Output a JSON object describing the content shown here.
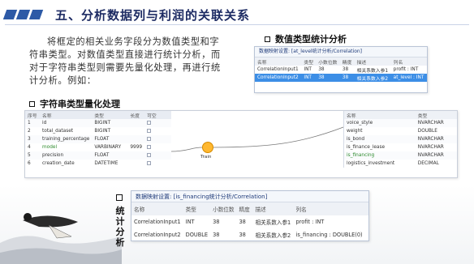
{
  "header": {
    "title": "五、分析数据列与利润的关联关系"
  },
  "intro": {
    "text": "将框定的相关业务字段分为数值类型和字符串类型。对数值类型直接进行统计分析，而对于字符串类型则需要先量化处理，再进行统计分析。例如："
  },
  "sections": {
    "numeric": "数值类型统计分析",
    "string": "字符串类型量化处理",
    "stats_chars": [
      "统",
      "计",
      "分",
      "析"
    ]
  },
  "numeric_panel": {
    "title": "数据映射设置: [at_level统计分析/Correlation]",
    "columns": [
      "名称",
      "类型",
      "小数位数",
      "精度",
      "描述",
      "列名"
    ],
    "rows": [
      [
        "CorrelationInput1",
        "INT",
        "38",
        "38",
        "相关系数入参1",
        "profit : INT"
      ],
      [
        "CorrelationInput2",
        "INT",
        "38",
        "38",
        "相关系数入参2",
        "at_level : INT"
      ]
    ]
  },
  "flow_left": {
    "columns": [
      "序号",
      "名称",
      "类型",
      "长度",
      "可空"
    ],
    "rows": [
      [
        "1",
        "id",
        "BIGINT",
        "",
        ""
      ],
      [
        "2",
        "total_dataset",
        "BIGINT",
        "",
        ""
      ],
      [
        "3",
        "training_percentage",
        "FLOAT",
        "",
        ""
      ],
      [
        "4",
        "model",
        "VARBINARY",
        "9999",
        ""
      ],
      [
        "5",
        "precision",
        "FLOAT",
        "",
        ""
      ],
      [
        "6",
        "creation_date",
        "DATETIME",
        "",
        ""
      ]
    ]
  },
  "flow_node": {
    "label": "Train"
  },
  "flow_right": {
    "columns": [
      "名称",
      "类型"
    ],
    "rows": [
      [
        "voice_style",
        "NVARCHAR"
      ],
      [
        "weight",
        "DOUBLE"
      ],
      [
        "is_bond",
        "NVARCHAR"
      ],
      [
        "is_finance_lease",
        "NVARCHAR"
      ],
      [
        "is_financing",
        "NVARCHAR"
      ],
      [
        "logistics_investment",
        "DECIMAL"
      ]
    ]
  },
  "stat_panel": {
    "title": "数据映射设置: [is_financing统计分析/Correlation]",
    "columns": [
      "名称",
      "类型",
      "小数位数",
      "精度",
      "描述",
      "列名"
    ],
    "rows": [
      [
        "CorrelationInput1",
        "INT",
        "38",
        "38",
        "相关系数入参1",
        "profit : INT"
      ],
      [
        "CorrelationInput2",
        "DOUBLE",
        "38",
        "38",
        "相关系数入参2",
        "is_financing : DOUBLE(0)"
      ]
    ]
  },
  "colors": {
    "accent": "#2d5aa6",
    "title": "#1d2b63",
    "selection": "#3c8ee6",
    "highlight_green": "#2e8b2e"
  }
}
